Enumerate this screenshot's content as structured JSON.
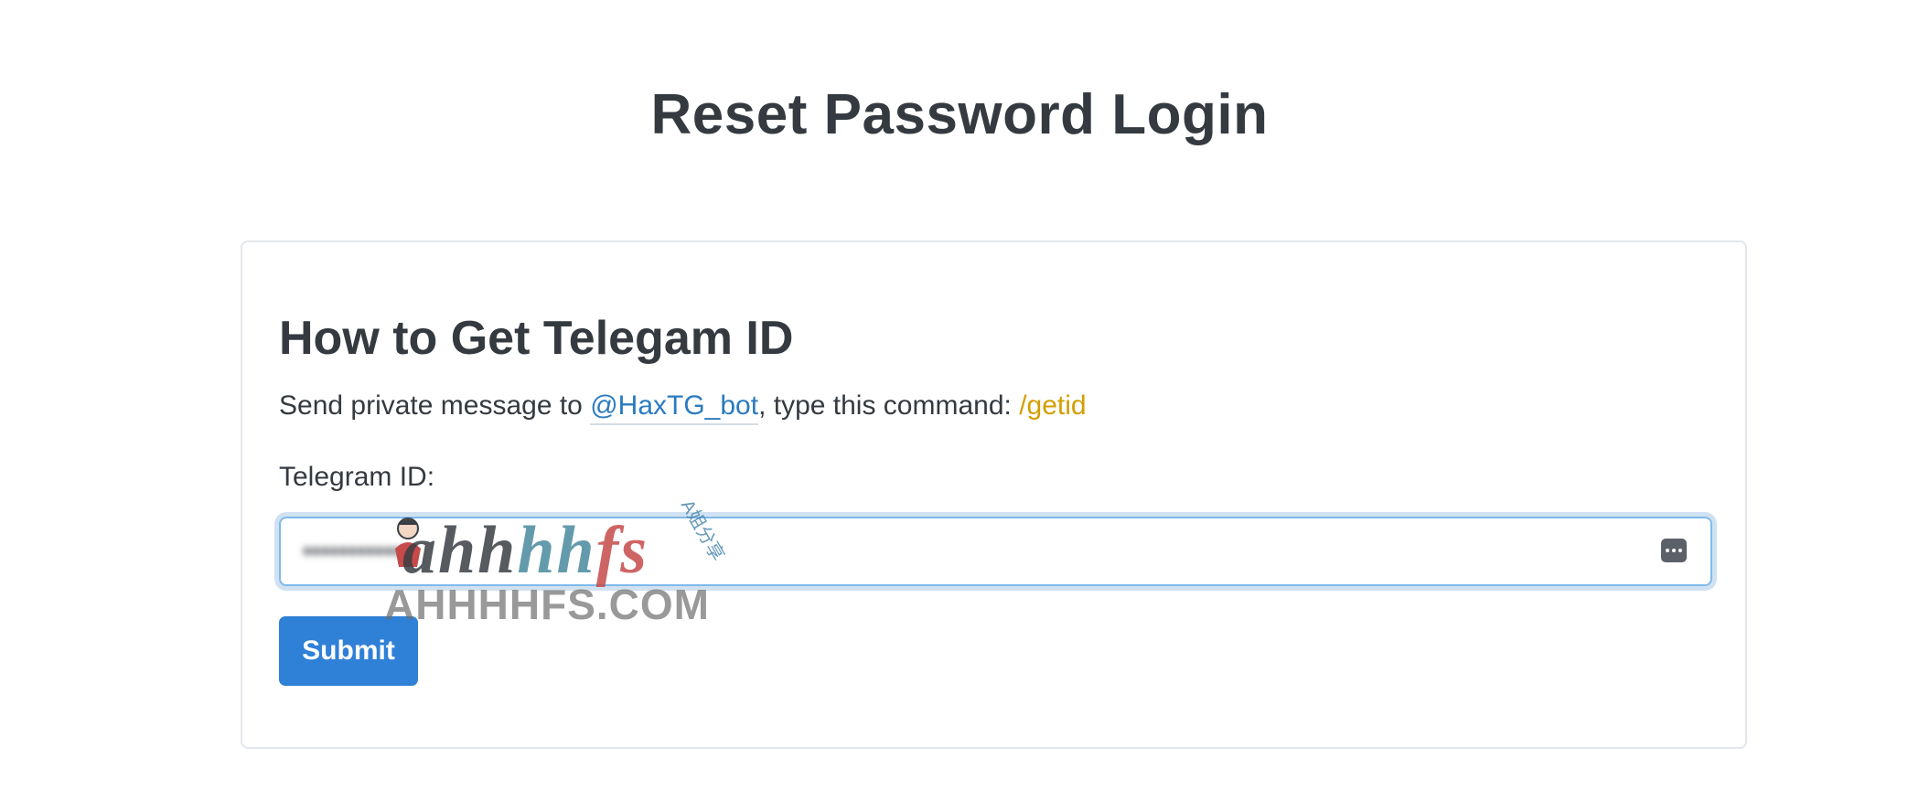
{
  "page": {
    "title": "Reset Password Login"
  },
  "card": {
    "heading": "How to Get Telegam ID",
    "instruction_prefix": "Send private message to ",
    "bot_link": "@HaxTG_bot",
    "instruction_middle": ", type this command: ",
    "command": "/getid",
    "field_label": "Telegram ID:",
    "input_value": "••••••••••••",
    "input_icon": "password-manager-icon",
    "submit_label": "Submit"
  },
  "watermark": {
    "logo_part1": "ahh",
    "logo_part2": "hh",
    "logo_part3": "fs",
    "sub_text": "A姐分享",
    "domain": "AHHHHFS.COM"
  },
  "colors": {
    "link": "#2b7bbf",
    "command": "#d39e00",
    "button": "#2f80d7",
    "text": "#343a40"
  }
}
